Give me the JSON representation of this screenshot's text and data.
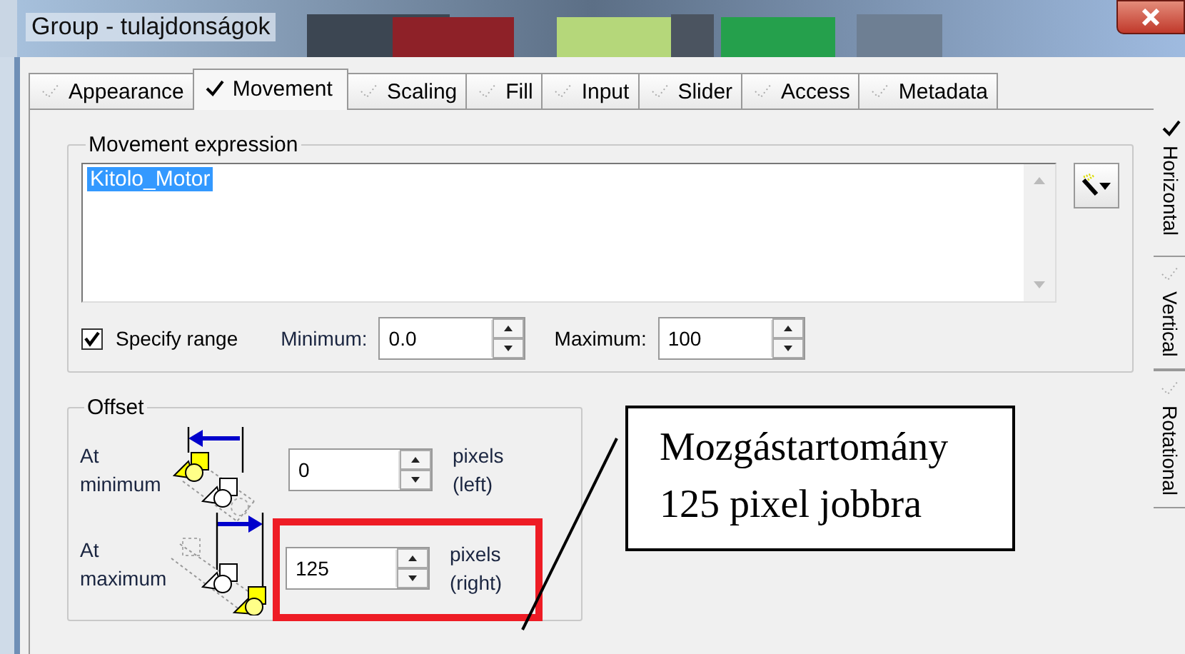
{
  "window": {
    "title": "Group - tulajdonságok"
  },
  "tabs": [
    {
      "label": "Appearance",
      "selected": false,
      "checked": false
    },
    {
      "label": "Movement",
      "selected": true,
      "checked": true
    },
    {
      "label": "Scaling",
      "selected": false,
      "checked": false
    },
    {
      "label": "Fill",
      "selected": false,
      "checked": false
    },
    {
      "label": "Input",
      "selected": false,
      "checked": false
    },
    {
      "label": "Slider",
      "selected": false,
      "checked": false
    },
    {
      "label": "Access",
      "selected": false,
      "checked": false
    },
    {
      "label": "Metadata",
      "selected": false,
      "checked": false
    }
  ],
  "movement_expression": {
    "legend": "Movement expression",
    "value": "Kitolo_Motor",
    "text_selected": true
  },
  "range": {
    "label": "Specify range",
    "checked": true,
    "minimum_label": "Minimum:",
    "minimum": "0.0",
    "maximum_label": "Maximum:",
    "maximum": "100"
  },
  "offset": {
    "legend": "Offset",
    "rows": [
      {
        "label": "At minimum",
        "value": "0",
        "unit": "pixels (left)",
        "kind": "left",
        "highlighted": false
      },
      {
        "label": "At maximum",
        "value": "125",
        "unit": "pixels (right)",
        "kind": "right",
        "highlighted": true
      }
    ]
  },
  "callout": {
    "text": "Mozgástartomány 125 pixel jobbra"
  },
  "side_tabs": [
    {
      "label": "Horizontal",
      "selected": true,
      "checked": true
    },
    {
      "label": "Vertical",
      "selected": false,
      "checked": false
    },
    {
      "label": "Rotational",
      "selected": false,
      "checked": false
    }
  ]
}
